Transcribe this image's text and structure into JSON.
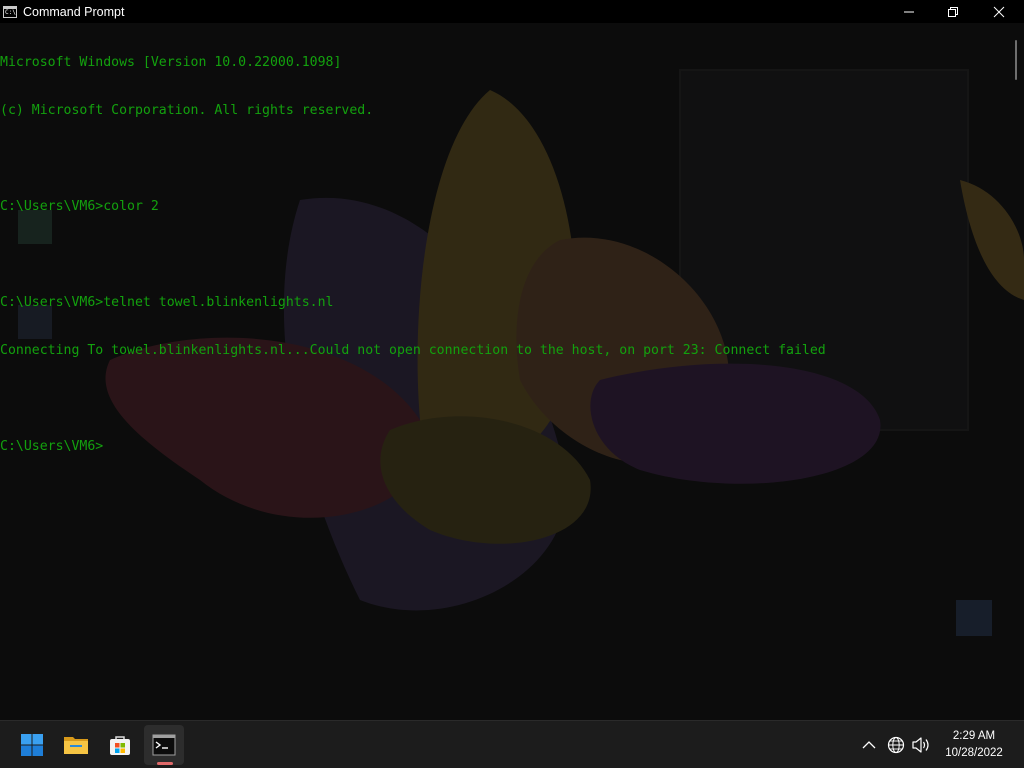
{
  "window": {
    "title": "Command Prompt",
    "app_icon": "cmd-icon",
    "controls": [
      "minimize-icon",
      "maximize-icon",
      "close-icon"
    ]
  },
  "console": {
    "text_color": "#13a10e",
    "background": "#0c0c0c",
    "lines": [
      "Microsoft Windows [Version 10.0.22000.1098]",
      "(c) Microsoft Corporation. All rights reserved.",
      "",
      "C:\\Users\\VM6>color 2",
      "",
      "C:\\Users\\VM6>telnet towel.blinkenlights.nl",
      "Connecting To towel.blinkenlights.nl...Could not open connection to the host, on port 23: Connect failed",
      "",
      "C:\\Users\\VM6>"
    ]
  },
  "taskbar": {
    "apps": [
      {
        "name": "Start",
        "icon": "windows-start-icon"
      },
      {
        "name": "File Explorer",
        "icon": "folder-icon"
      },
      {
        "name": "Microsoft Store",
        "icon": "store-icon"
      },
      {
        "name": "Command Prompt",
        "icon": "cmd-icon",
        "active": true
      }
    ],
    "tray": {
      "icons": [
        "chevron-up-icon",
        "globe-icon",
        "speaker-icon"
      ],
      "time": "2:29 AM",
      "date": "10/28/2022"
    }
  }
}
